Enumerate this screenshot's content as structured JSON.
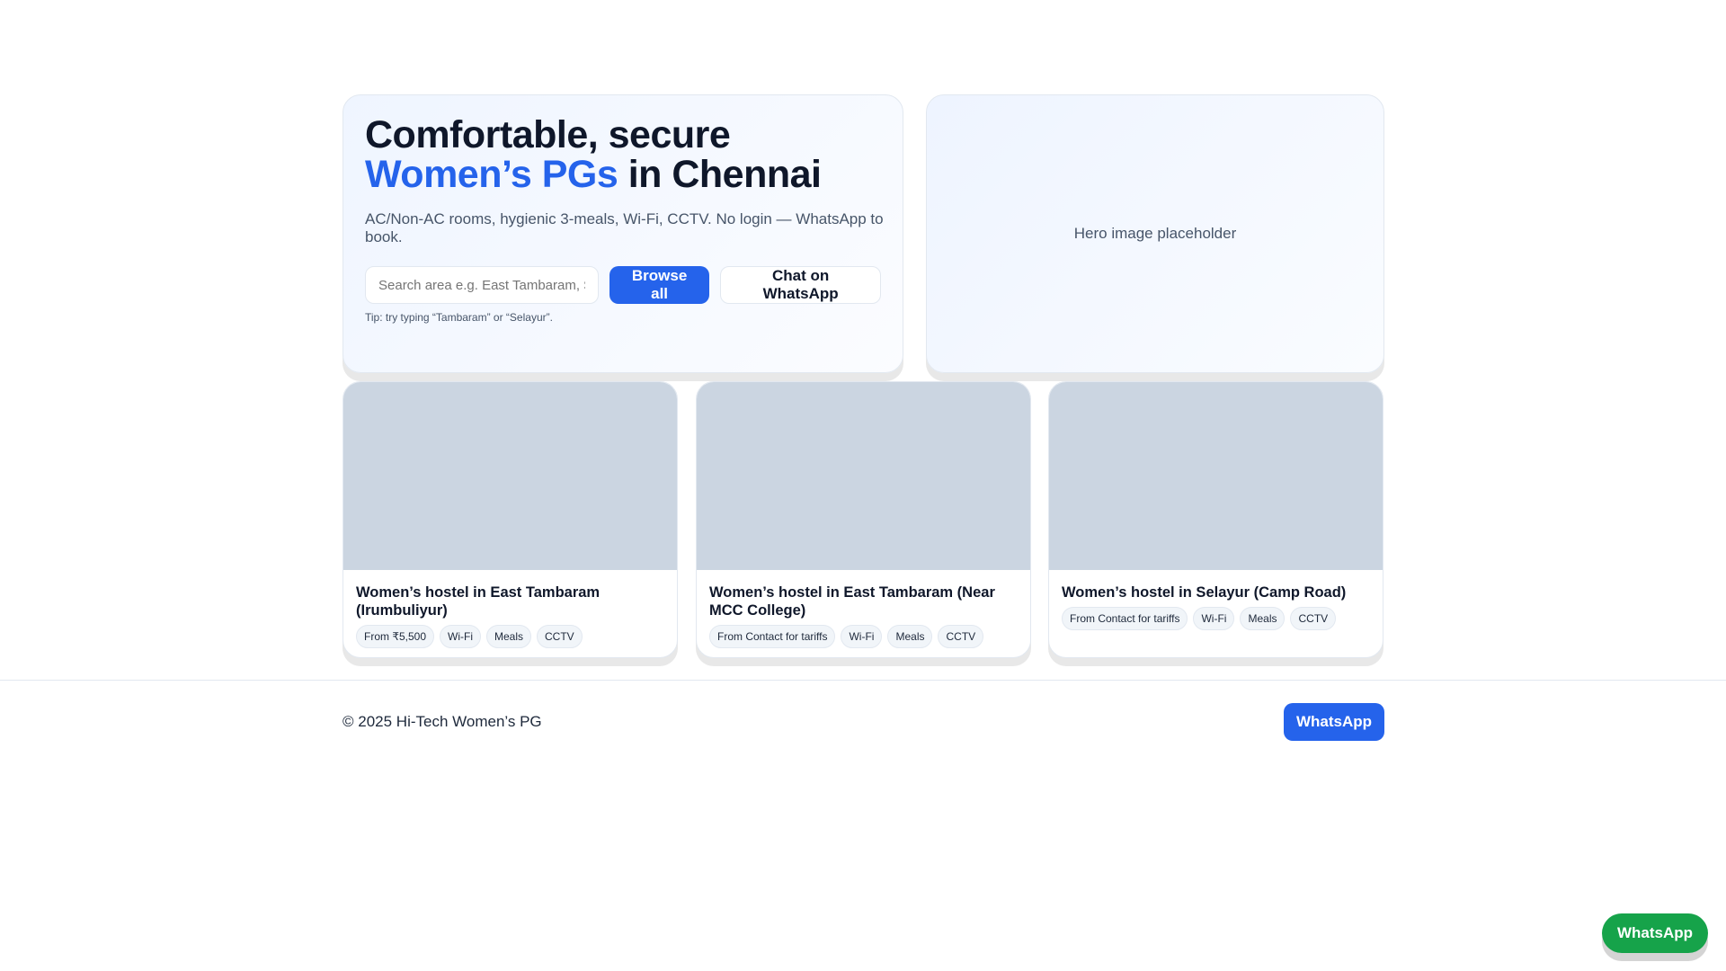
{
  "hero": {
    "title_line1": "Comfortable, secure",
    "title_accent": "Women’s PGs",
    "title_rest": " in Chennai",
    "subtitle": "AC/Non-AC rooms, hygienic 3-meals, Wi-Fi, CCTV. No login — WhatsApp to book.",
    "search_placeholder": "Search area e.g. East Tambaram, Selayur",
    "browse_label": "Browse all",
    "chat_label": "Chat on WhatsApp",
    "tip": "Tip: try typing “Tambaram” or “Selayur”."
  },
  "hero_image": {
    "label": "Hero image placeholder"
  },
  "listings": [
    {
      "title": "Women’s hostel in East Tambaram (Irumbuliyur)",
      "chips": [
        "From ₹5,500",
        "Wi-Fi",
        "Meals",
        "CCTV"
      ]
    },
    {
      "title": "Women’s hostel in East Tambaram (Near MCC College)",
      "chips": [
        "From Contact for tariffs",
        "Wi-Fi",
        "Meals",
        "CCTV"
      ]
    },
    {
      "title": "Women’s hostel in Selayur (Camp Road)",
      "chips": [
        "From Contact for tariffs",
        "Wi-Fi",
        "Meals",
        "CCTV"
      ]
    }
  ],
  "footer": {
    "copyright": "© 2025 Hi-Tech Women’s PG",
    "whatsapp_label": "WhatsApp"
  },
  "floating": {
    "whatsapp_label": "WhatsApp"
  },
  "colors": {
    "accent": "#2563eb",
    "whatsapp": "#16a34a",
    "placeholder": "#cbd5e1"
  }
}
